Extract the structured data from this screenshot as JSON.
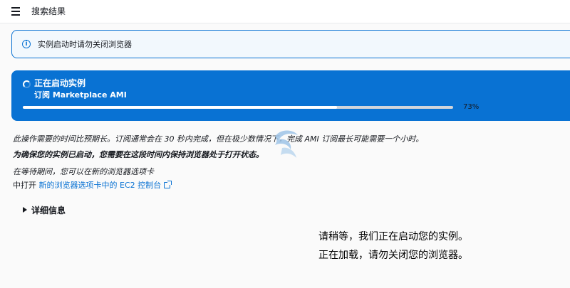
{
  "header": {
    "title": "搜索结果"
  },
  "alert": {
    "text": "实例启动时请勿关闭浏览器"
  },
  "progress": {
    "status": "正在启动实例",
    "subtitle": "订阅 Marketplace AMI",
    "value_percent": 73,
    "label": "73%"
  },
  "notes": {
    "duration": "此操作需要的时间比预期长。订阅通常会在 30 秒内完成，但在极少数情况下，完成 AMI 订阅最长可能需要一个小时。",
    "keep_open": "为确保您的实例已启动，您需要在这段时间内保持浏览器处于打开状态。",
    "while_waiting": "在等待期间，您可以在新的浏览器选项卡",
    "open_prefix": "中打开",
    "console_link": "新的浏览器选项卡中的 EC2 控制台"
  },
  "details": {
    "label": "详细信息"
  },
  "overlay": {
    "line1": "请稍等，我们正在启动您的实例。",
    "line2": "正在加载，请勿关闭您的浏览器。"
  },
  "colors": {
    "accent": "#0972d3",
    "alert_bg": "#f2f8fd",
    "page_bg": "#fafafa"
  },
  "icons": {
    "menu": "hamburger-menu-icon",
    "info": "info-icon",
    "spinner": "loading-spinner-icon",
    "external": "external-link-icon",
    "caret": "caret-right-icon"
  }
}
